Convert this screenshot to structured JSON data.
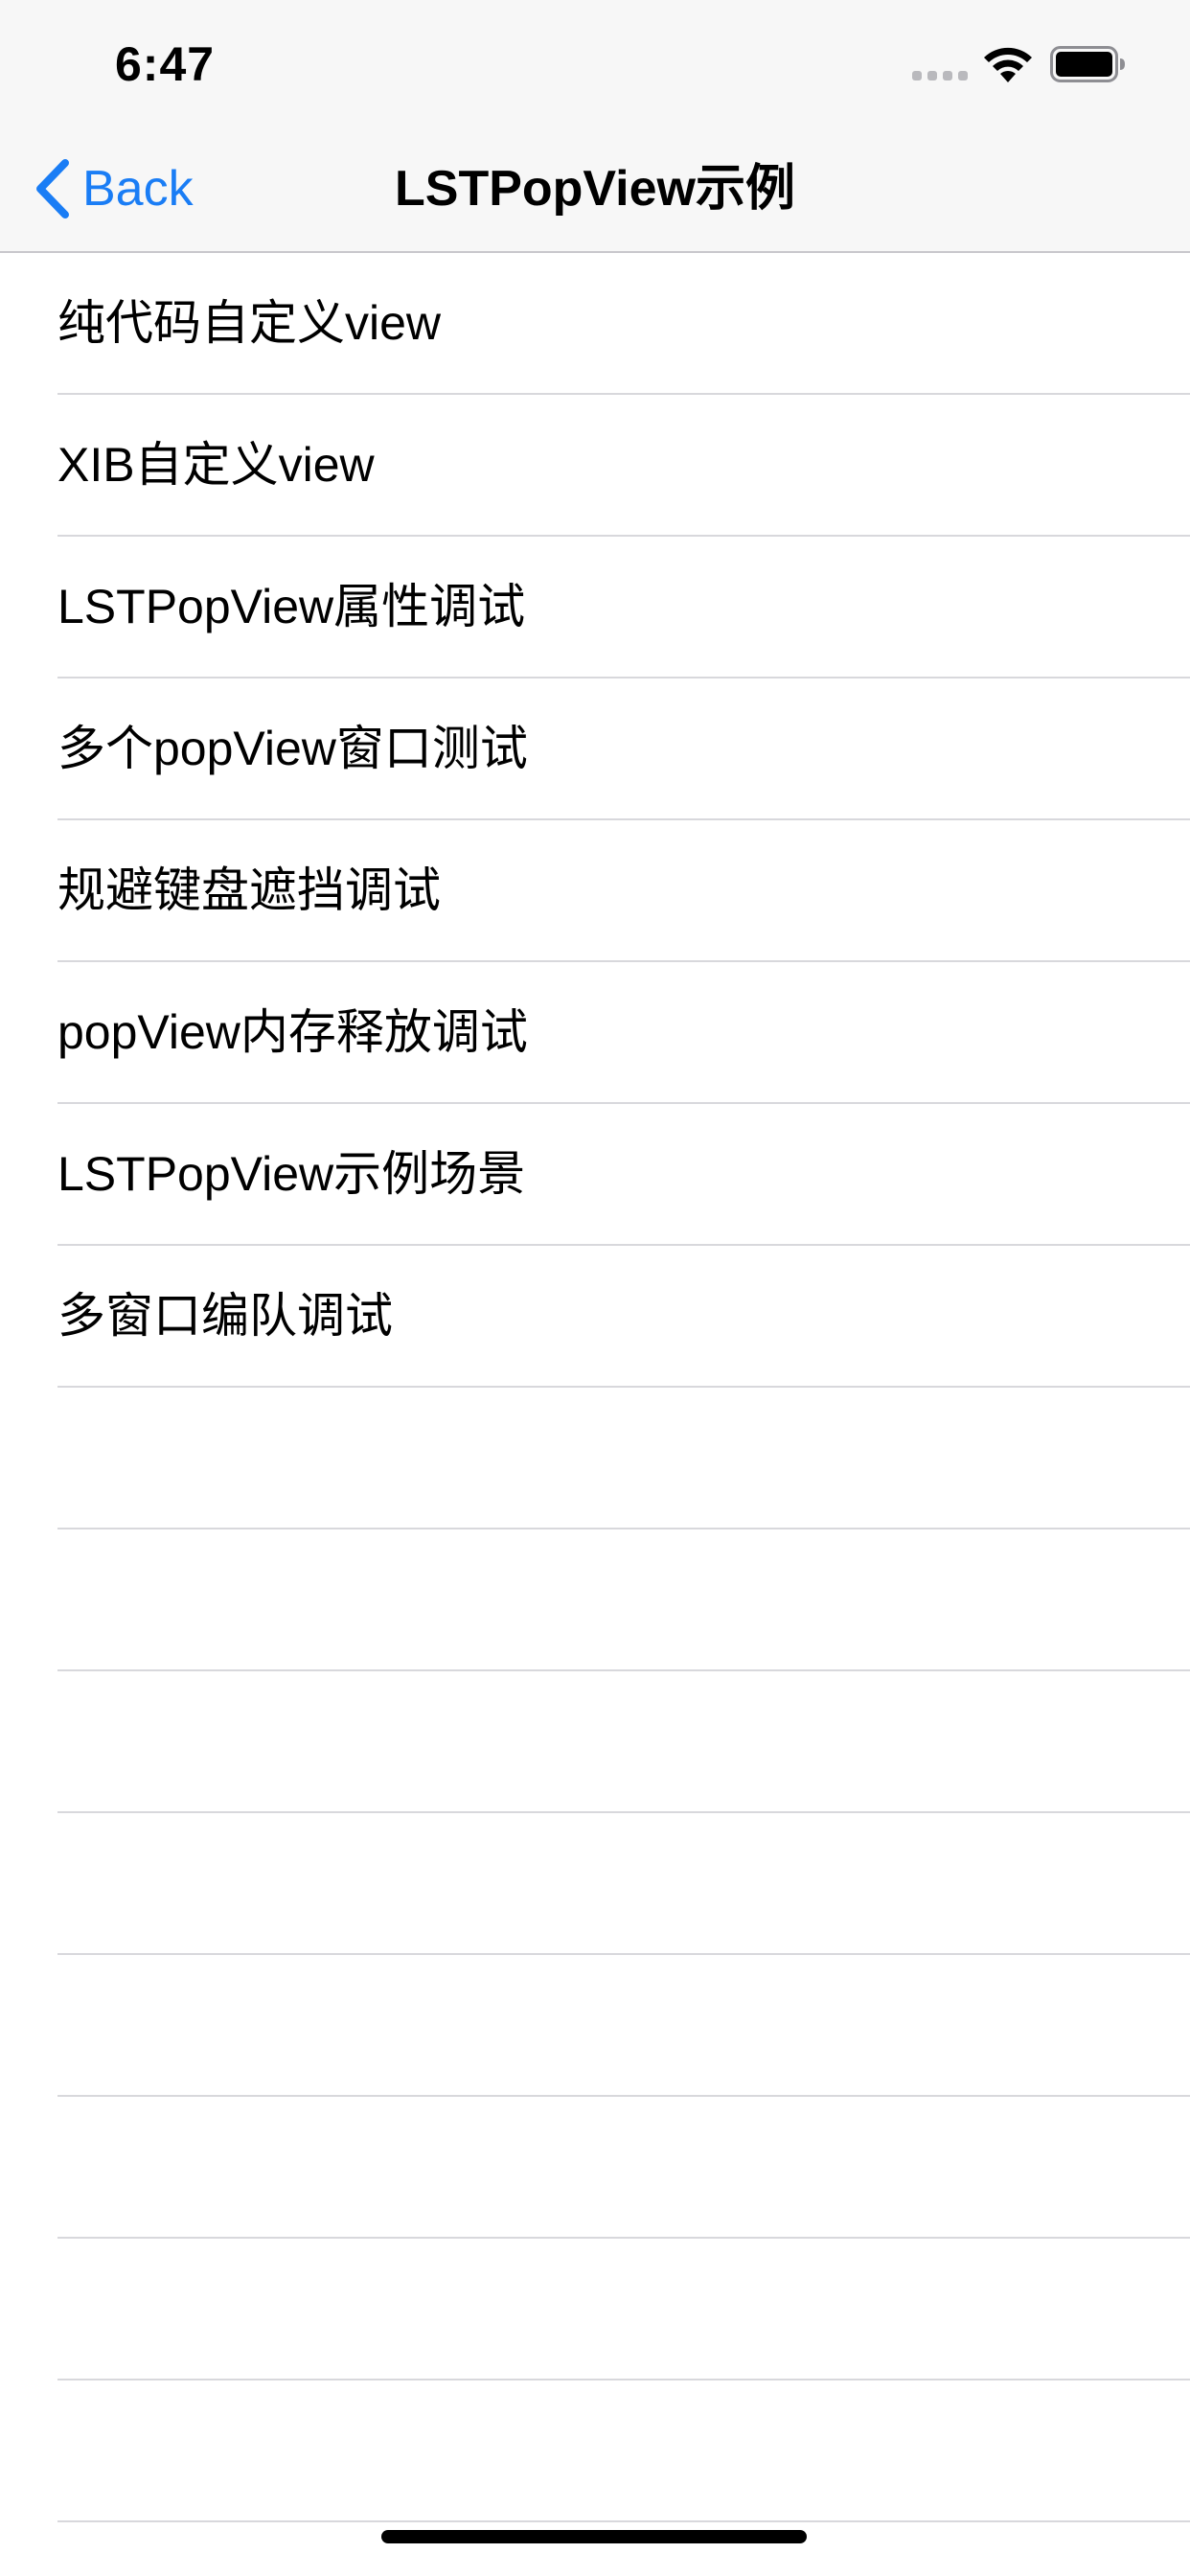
{
  "status_bar": {
    "time": "6:47",
    "icons": [
      "cellular-signal-icon",
      "wifi-icon",
      "battery-icon"
    ]
  },
  "nav_bar": {
    "back_label": "Back",
    "back_icon": "chevron-left-icon",
    "title": "LSTPopView示例"
  },
  "colors": {
    "accent": "#1a7df5",
    "bar_background": "#f7f7f7",
    "separator": "#d8d8dc"
  },
  "table": {
    "rows": [
      {
        "label": "纯代码自定义view"
      },
      {
        "label": "XIB自定义view"
      },
      {
        "label": "LSTPopView属性调试"
      },
      {
        "label": "多个popView窗口测试"
      },
      {
        "label": "规避键盘遮挡调试"
      },
      {
        "label": "popView内存释放调试"
      },
      {
        "label": "LSTPopView示例场景"
      },
      {
        "label": "多窗口编队调试"
      },
      {
        "label": ""
      },
      {
        "label": ""
      },
      {
        "label": ""
      },
      {
        "label": ""
      },
      {
        "label": ""
      },
      {
        "label": ""
      },
      {
        "label": ""
      },
      {
        "label": ""
      }
    ]
  }
}
